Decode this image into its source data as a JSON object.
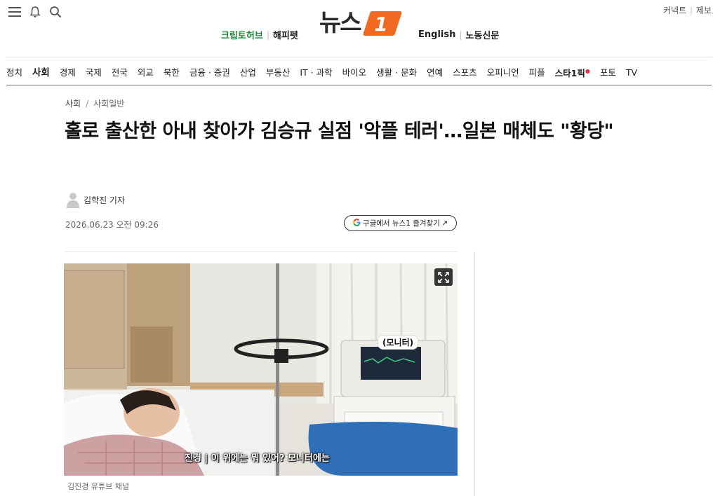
{
  "header": {
    "promo_left": [
      "크립토허브",
      "해피펫"
    ],
    "logo_text": "뉴스",
    "logo_badge": "1",
    "promo_right": [
      "English",
      "노동신문"
    ],
    "top_links": [
      "커넥트",
      "제보"
    ]
  },
  "nav": {
    "items": [
      "정치",
      "사회",
      "경제",
      "국제",
      "전국",
      "외교",
      "북한",
      "금융 · 증권",
      "산업",
      "부동산",
      "IT · 과학",
      "바이오",
      "생활 · 문화",
      "연예",
      "스포츠",
      "오피니언",
      "피플",
      "스타1픽",
      "포토",
      "TV"
    ],
    "active": "사회"
  },
  "article": {
    "breadcrumb": [
      "사회",
      "사회일반"
    ],
    "headline": "홀로 출산한 아내 찾아가 김승규 실점 '악플 테러'…일본 매체도 \"황당\"",
    "author": "김학진 기자",
    "date": "2026.06.23 오전 09:26",
    "google_button": "구글에서 뉴스1 즐겨찾기",
    "photo": {
      "label": "(모니터)",
      "subtitle": "진경 | 이 위에는 뭐 있어? 모니터에는",
      "credit": "김진경 유튜브 채널"
    }
  },
  "colors": {
    "brand_orange": "#f26a21",
    "promo_green": "#1f8a3a",
    "star_red": "#e2334d"
  }
}
